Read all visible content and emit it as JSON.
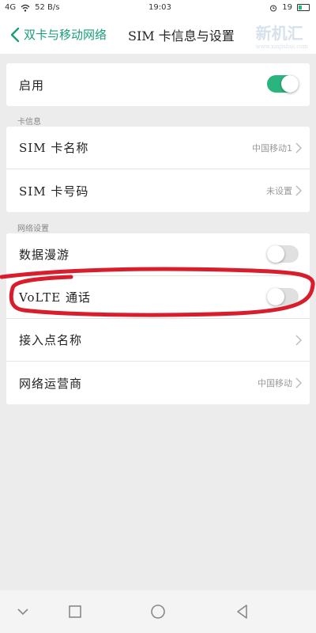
{
  "status_bar": {
    "signal": "4G",
    "speed": "52 B/s",
    "time": "19:03",
    "battery": "19"
  },
  "header": {
    "back_label": "双卡与移动网络",
    "title": "SIM 卡信息与设置",
    "watermark": "新机汇",
    "watermark_url": "www.xinjishui.com"
  },
  "enable_row": {
    "label": "启用",
    "toggle": "on"
  },
  "sections": {
    "card_info": {
      "header": "卡信息",
      "rows": [
        {
          "label": "SIM 卡名称",
          "value": "中国移动1"
        },
        {
          "label": "SIM 卡号码",
          "value": "未设置"
        }
      ]
    },
    "network": {
      "header": "网络设置",
      "rows": [
        {
          "label": "数据漫游",
          "toggle": "off"
        },
        {
          "label": "VoLTE 通话",
          "toggle": "off"
        },
        {
          "label": "接入点名称",
          "value": ""
        },
        {
          "label": "网络运营商",
          "value": "中国移动"
        }
      ]
    }
  },
  "colors": {
    "accent": "#1a9e7a",
    "toggle_on": "#2bb57e",
    "annotation": "#d81e2c"
  },
  "icons": {
    "back": "chevron-left-icon",
    "chevron": "chevron-right-icon",
    "nav_back": "triangle-back-icon",
    "nav_home": "circle-home-icon",
    "nav_recent": "square-recent-icon",
    "nav_down": "chevron-down-icon"
  }
}
